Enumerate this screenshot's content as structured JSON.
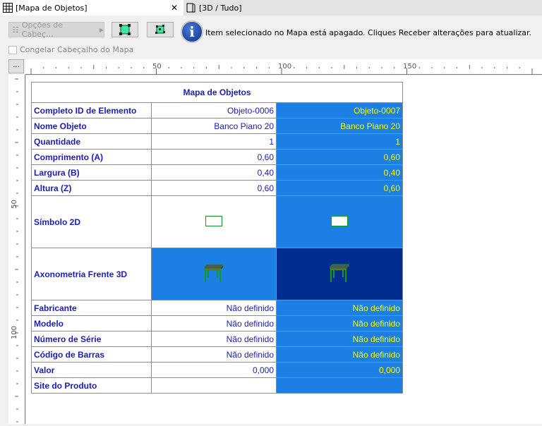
{
  "tabs": [
    {
      "label": "[Mapa de Objetos]",
      "icon": "grid-icon",
      "active": true
    },
    {
      "label": "[3D / Tudo]",
      "icon": "3d-box-icon",
      "active": false
    }
  ],
  "toolbar": {
    "header_options": "Opções de Cabeç...",
    "message": "Item selecionado no Mapa está apagado. Cliques Receber alterações para atualizar.",
    "freeze_label": "Congelar Cabeçalho do Mapa",
    "freeze_checked": false,
    "more": "..."
  },
  "ruler": {
    "top_labels": [
      "50",
      "100",
      "150"
    ],
    "left_labels": [
      "50",
      "100"
    ]
  },
  "table": {
    "title": "Mapa de Objetos",
    "colors": {
      "label": "#1a1acc",
      "selected_bg": "#1c7fe3",
      "selected_text": "#ffff00",
      "dark_bg": "#002d8f"
    },
    "rows": [
      {
        "label": "Completo ID de Elemento",
        "v1": "Objeto-0006",
        "v2": "Objeto-0007"
      },
      {
        "label": "Nome Objeto",
        "v1": "Banco Piano 20",
        "v2": "Banco Piano 20"
      },
      {
        "label": "Quantidade",
        "v1": "1",
        "v2": "1"
      },
      {
        "label": "Comprimento (A)",
        "v1": "0,60",
        "v2": "0,60"
      },
      {
        "label": "Largura (B)",
        "v1": "0,40",
        "v2": "0,40"
      },
      {
        "label": "Altura (Z)",
        "v1": "0,60",
        "v2": "0,60"
      },
      {
        "label": "Símbolo 2D"
      },
      {
        "label": "Axonometria Frente 3D"
      },
      {
        "label": "Fabricante",
        "v1": "Não definido",
        "v2": "Não definido"
      },
      {
        "label": "Modelo",
        "v1": "Não definido",
        "v2": "Não definido"
      },
      {
        "label": "Número de Série",
        "v1": "Não definido",
        "v2": "Não definido"
      },
      {
        "label": "Código de Barras",
        "v1": "Não definido",
        "v2": "Não definido"
      },
      {
        "label": "Valor",
        "v1": "0,000",
        "v2": "0,000"
      },
      {
        "label": "Site do Produto",
        "v1": "",
        "v2": ""
      }
    ]
  }
}
